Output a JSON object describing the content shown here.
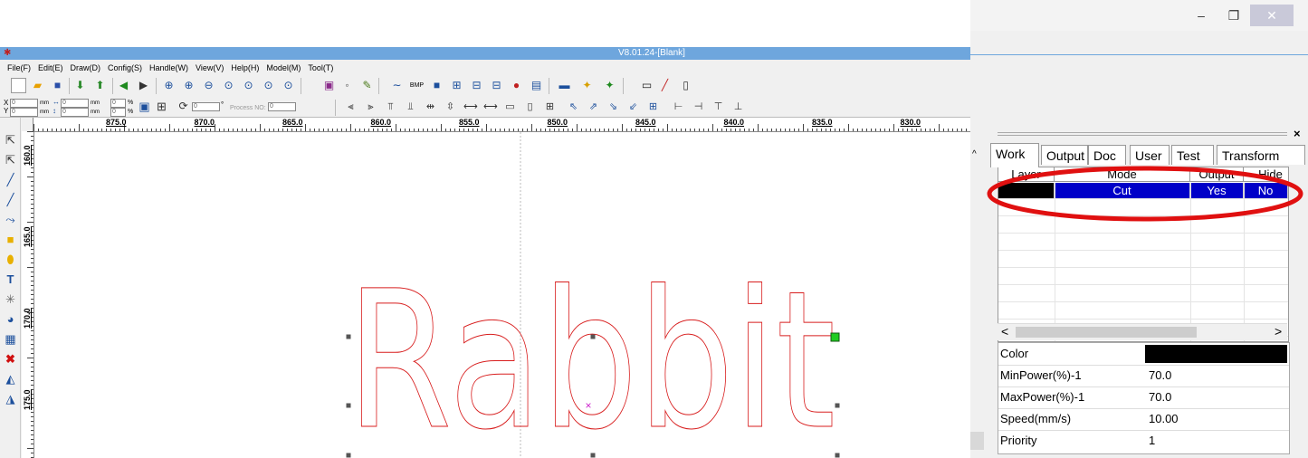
{
  "window": {
    "title": "V8.01.24-[Blank]",
    "minimize_label": "–",
    "restore_label": "❐",
    "close_label": "✕"
  },
  "menu": [
    "File(F)",
    "Edit(E)",
    "Draw(D)",
    "Config(S)",
    "Handle(W)",
    "View(V)",
    "Help(H)",
    "Model(M)",
    "Tool(T)"
  ],
  "position_bar": {
    "x_label": "X",
    "y_label": "Y",
    "x_value": "0",
    "y_value": "0",
    "w_value": "0",
    "h_value": "0",
    "unit_mm": "mm",
    "scale_x": "0",
    "scale_y": "0",
    "percent": "%",
    "rotate_value": "0",
    "degree": "°",
    "process_no_label": "Process NO:",
    "process_no_value": "0"
  },
  "rulers": {
    "horizontal": [
      "875.0",
      "870.0",
      "865.0",
      "860.0",
      "855.0",
      "850.0",
      "845.0",
      "840.0",
      "835.0",
      "830.0",
      "825.0"
    ],
    "vertical": [
      "160.0",
      "165.0",
      "170.0",
      "175.0"
    ]
  },
  "canvas": {
    "text": "Rabbit",
    "outline_color": "#d81e1e",
    "handle_color": "#555555",
    "corner_handle_color": "#22cc22",
    "center_mark": "×",
    "center_mark_color": "#cc22cc"
  },
  "panel": {
    "close_label": "×",
    "tabs": [
      "Work",
      "Output",
      "Doc",
      "User",
      "Test",
      "Transform"
    ],
    "active_tab": "Work",
    "columns": [
      "Layer",
      "Mode",
      "Output",
      "Hide"
    ],
    "layers": [
      {
        "color": "#000000",
        "mode": "Cut",
        "output": "Yes",
        "hide": "No"
      }
    ],
    "selection_color": "#0000c8",
    "highlight_ellipse_color": "#e01010",
    "scroll_left": "<",
    "scroll_right": ">",
    "scroll_up": "^",
    "properties": [
      {
        "key": "Color",
        "value": ""
      },
      {
        "key": "MinPower(%)-1",
        "value": "70.0"
      },
      {
        "key": "MaxPower(%)-1",
        "value": "70.0"
      },
      {
        "key": "Speed(mm/s)",
        "value": "10.00"
      },
      {
        "key": "Priority",
        "value": "1"
      }
    ],
    "color_swatch": "#000000"
  }
}
